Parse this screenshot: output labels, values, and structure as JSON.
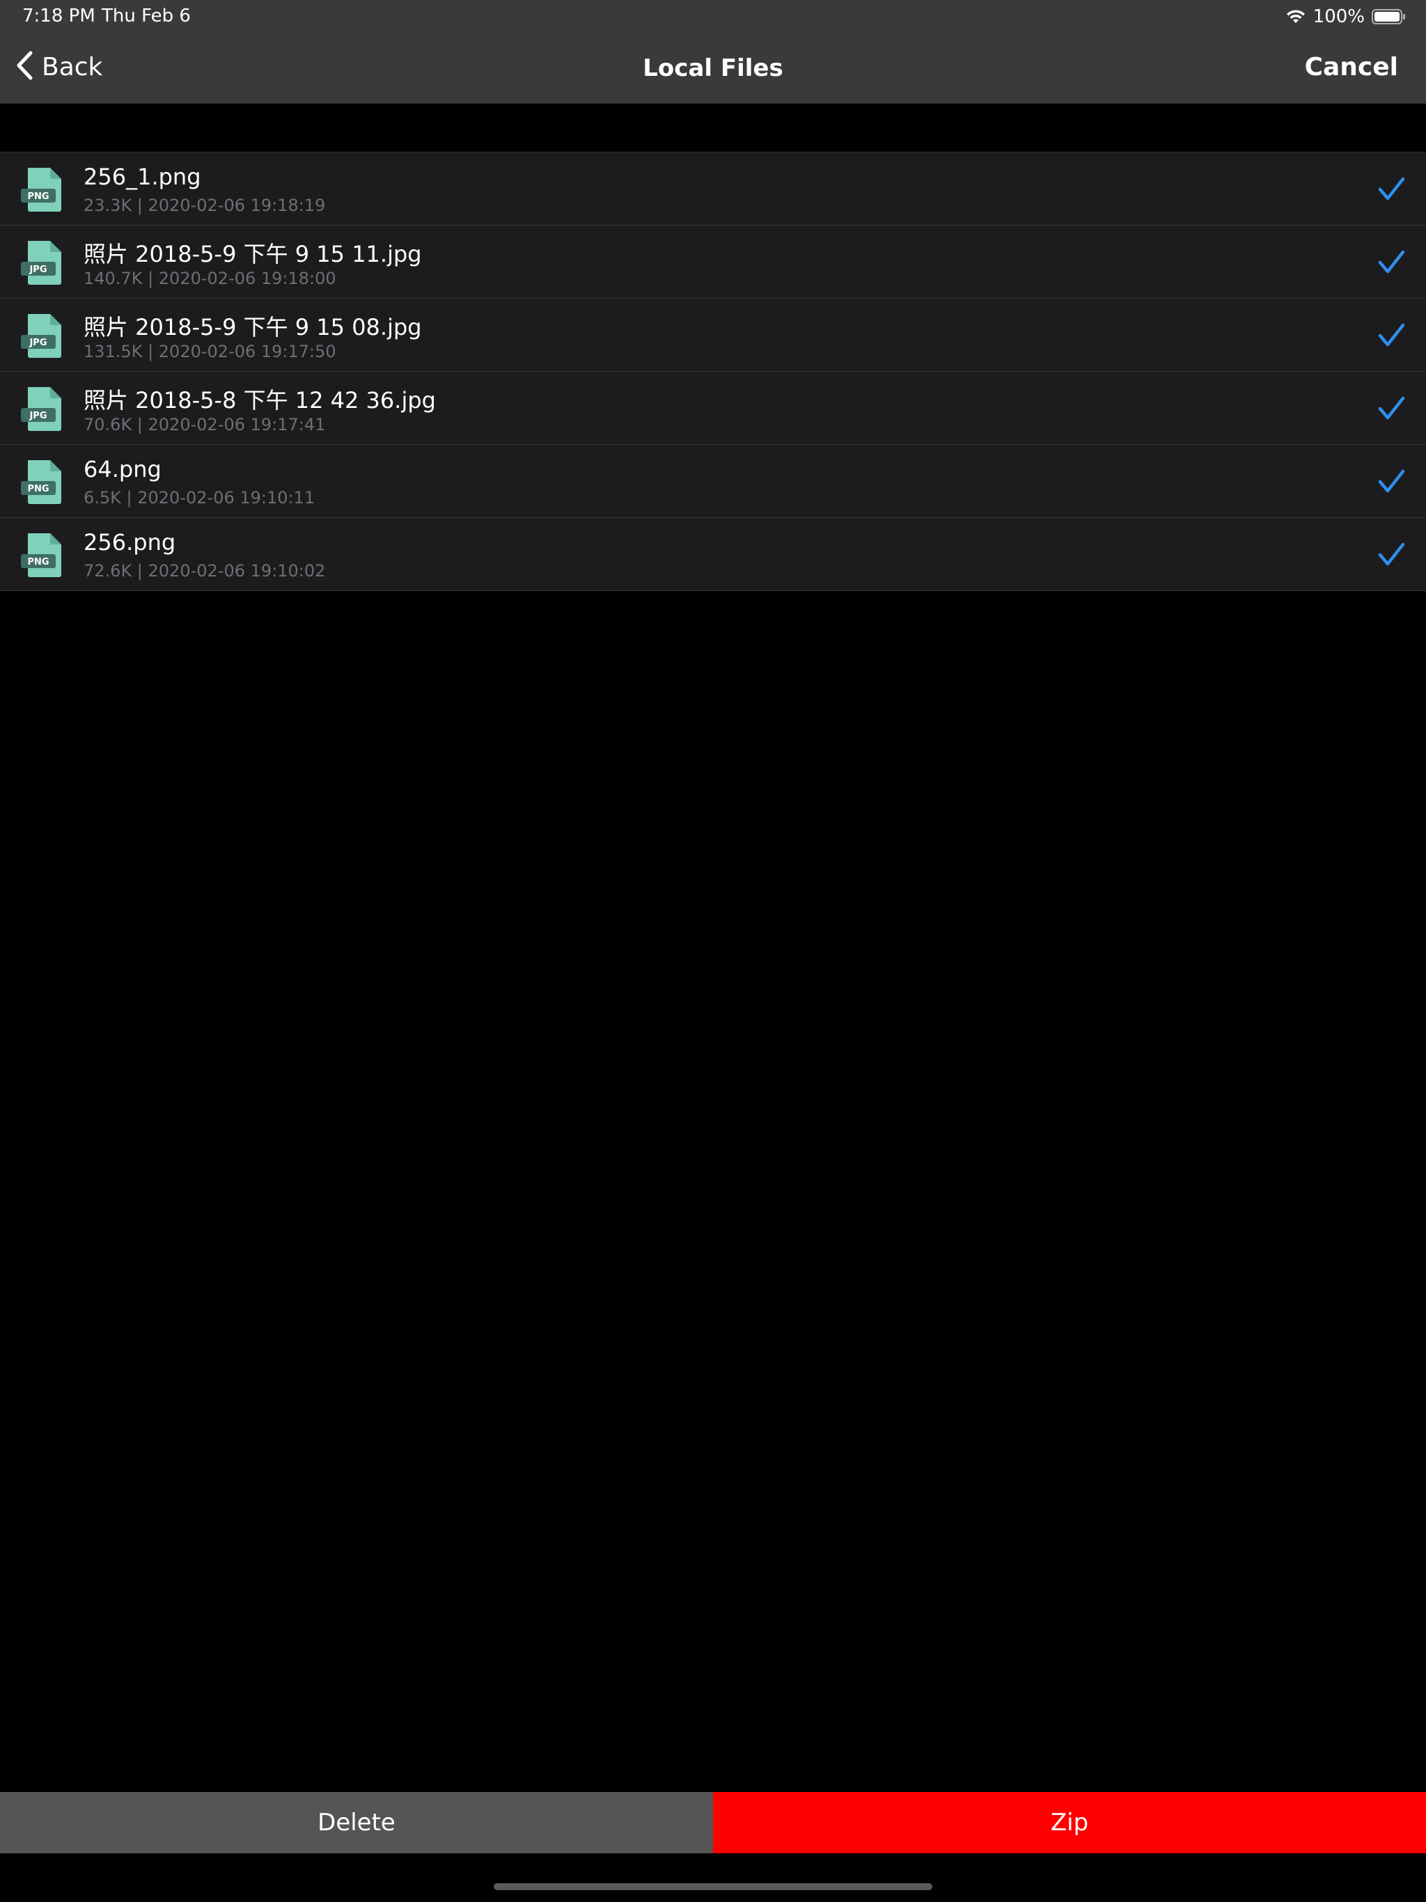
{
  "status_bar": {
    "time": "7:18 PM",
    "date": "Thu Feb 6",
    "battery_percent": "100%"
  },
  "nav": {
    "back_label": "Back",
    "title": "Local Files",
    "cancel_label": "Cancel"
  },
  "files": [
    {
      "name": "256_1.png",
      "meta": "23.3K | 2020-02-06 19:18:19",
      "type": "PNG",
      "checked": true
    },
    {
      "name": "照片 2018-5-9 下午 9 15 11.jpg",
      "meta": "140.7K | 2020-02-06 19:18:00",
      "type": "JPG",
      "checked": true
    },
    {
      "name": "照片 2018-5-9 下午 9 15 08.jpg",
      "meta": "131.5K | 2020-02-06 19:17:50",
      "type": "JPG",
      "checked": true
    },
    {
      "name": "照片 2018-5-8 下午 12 42 36.jpg",
      "meta": "70.6K | 2020-02-06 19:17:41",
      "type": "JPG",
      "checked": true
    },
    {
      "name": "64.png",
      "meta": "6.5K | 2020-02-06 19:10:11",
      "type": "PNG",
      "checked": true
    },
    {
      "name": "256.png",
      "meta": "72.6K | 2020-02-06 19:10:02",
      "type": "PNG",
      "checked": true
    }
  ],
  "actions": {
    "delete_label": "Delete",
    "zip_label": "Zip"
  },
  "colors": {
    "bar_background": "#3a3a3c",
    "row_background": "#1c1c1e",
    "check_color": "#2f8ff0",
    "delete_background": "#555555",
    "zip_background": "#ff0000",
    "file_icon_color": "#7fd1b9"
  }
}
